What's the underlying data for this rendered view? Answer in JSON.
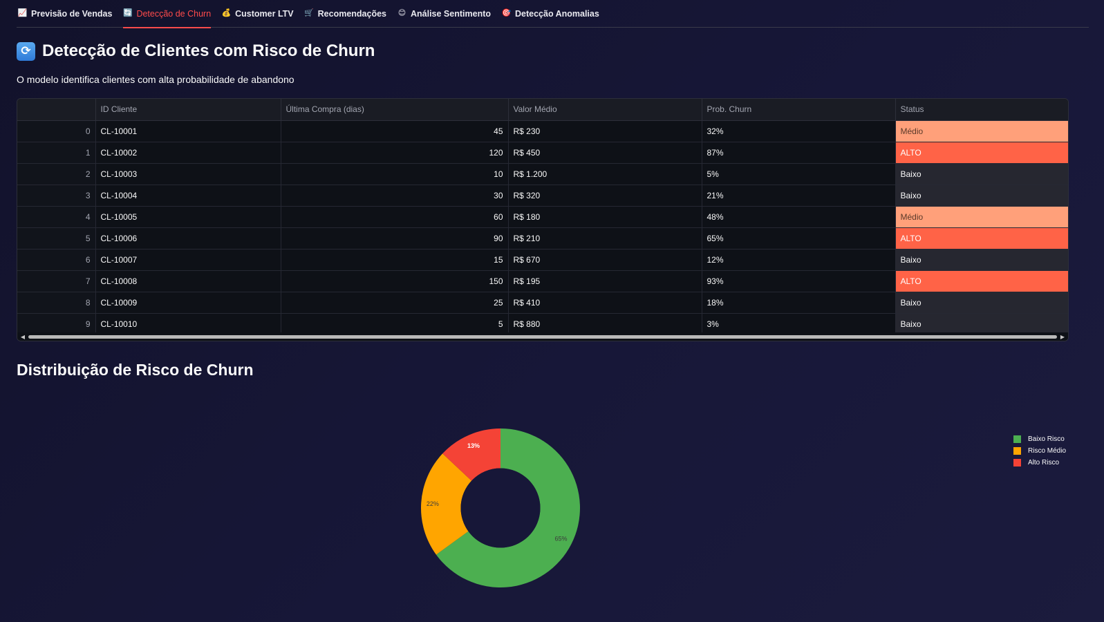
{
  "tabs": [
    {
      "icon": "chart-increasing-icon",
      "glyph": "📈",
      "label": "Previsão de Vendas",
      "active": false
    },
    {
      "icon": "refresh-icon",
      "glyph": "🔄",
      "label": "Detecção de Churn",
      "active": true
    },
    {
      "icon": "money-bag-icon",
      "glyph": "💰",
      "label": "Customer LTV",
      "active": false
    },
    {
      "icon": "shopping-cart-icon",
      "glyph": "🛒",
      "label": "Recomendações",
      "active": false
    },
    {
      "icon": "smiley-icon",
      "glyph": "😊",
      "label": "Análise Sentimento",
      "active": false
    },
    {
      "icon": "target-icon",
      "glyph": "🎯",
      "label": "Detecção Anomalias",
      "active": false
    }
  ],
  "page": {
    "title_icon": "refresh-icon",
    "title": "Detecção de Clientes com Risco de Churn",
    "subtitle": "O modelo identifica clientes com alta probabilidade de abandono"
  },
  "table": {
    "columns": [
      "",
      "ID Cliente",
      "Última Compra (dias)",
      "Valor Médio",
      "Prob. Churn",
      "Status"
    ],
    "rows": [
      {
        "idx": "0",
        "id": "CL-10001",
        "dias": "45",
        "valor": "R$ 230",
        "prob": "32%",
        "status": "Médio"
      },
      {
        "idx": "1",
        "id": "CL-10002",
        "dias": "120",
        "valor": "R$ 450",
        "prob": "87%",
        "status": "ALTO"
      },
      {
        "idx": "2",
        "id": "CL-10003",
        "dias": "10",
        "valor": "R$ 1.200",
        "prob": "5%",
        "status": "Baixo"
      },
      {
        "idx": "3",
        "id": "CL-10004",
        "dias": "30",
        "valor": "R$ 320",
        "prob": "21%",
        "status": "Baixo"
      },
      {
        "idx": "4",
        "id": "CL-10005",
        "dias": "60",
        "valor": "R$ 180",
        "prob": "48%",
        "status": "Médio"
      },
      {
        "idx": "5",
        "id": "CL-10006",
        "dias": "90",
        "valor": "R$ 210",
        "prob": "65%",
        "status": "ALTO"
      },
      {
        "idx": "6",
        "id": "CL-10007",
        "dias": "15",
        "valor": "R$ 670",
        "prob": "12%",
        "status": "Baixo"
      },
      {
        "idx": "7",
        "id": "CL-10008",
        "dias": "150",
        "valor": "R$ 195",
        "prob": "93%",
        "status": "ALTO"
      },
      {
        "idx": "8",
        "id": "CL-10009",
        "dias": "25",
        "valor": "R$ 410",
        "prob": "18%",
        "status": "Baixo"
      },
      {
        "idx": "9",
        "id": "CL-10010",
        "dias": "5",
        "valor": "R$ 880",
        "prob": "3%",
        "status": "Baixo"
      }
    ]
  },
  "section_title": "Distribuição de Risco de Churn",
  "chart_data": {
    "type": "pie",
    "hole": 0.5,
    "categories": [
      "Baixo Risco",
      "Risco Médio",
      "Alto Risco"
    ],
    "values": [
      65,
      22,
      13
    ],
    "labels": [
      "65%",
      "22%",
      "13%"
    ],
    "colors": [
      "#4caf50",
      "#ffa500",
      "#f44336"
    ],
    "legend_position": "top-right"
  }
}
